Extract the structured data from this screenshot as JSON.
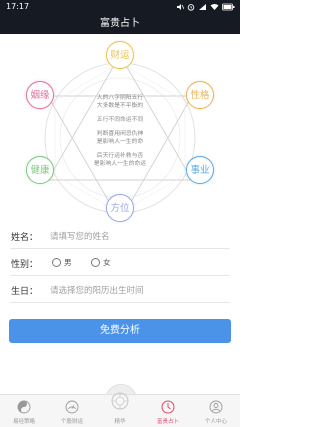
{
  "status_bar": {
    "time": "17:17"
  },
  "header": {
    "title": "富贵占卜"
  },
  "diagram": {
    "nodes": [
      {
        "key": "wealth",
        "label": "财运",
        "color": "#e8c356"
      },
      {
        "key": "character",
        "label": "性格",
        "color": "#e8b45a"
      },
      {
        "key": "career",
        "label": "事业",
        "color": "#5aa8e0"
      },
      {
        "key": "direction",
        "label": "方位",
        "color": "#9aa7e0"
      },
      {
        "key": "health",
        "label": "健康",
        "color": "#7ec77f"
      },
      {
        "key": "marriage",
        "label": "姻缘",
        "color": "#e36f9b"
      }
    ],
    "center_lines": [
      "人的八字阴阳五行",
      "大多数是不平衡的",
      "五行不同命运不同",
      "判断喜用闲忌仇神",
      "是影响人一生的命",
      "后天行运补救与否",
      "是影响人一生的命运"
    ]
  },
  "form": {
    "name": {
      "label": "姓名：",
      "placeholder": "请填写您的姓名"
    },
    "gender": {
      "label": "性别：",
      "options": [
        "男",
        "女"
      ]
    },
    "birthday": {
      "label": "生日：",
      "placeholder": "请选择您的阳历出生时间"
    }
  },
  "submit_label": "免费分析",
  "tabs": [
    {
      "label": "易经策略",
      "icon": "yin-yang-icon",
      "active": false
    },
    {
      "label": "个股财运",
      "icon": "gauge-icon",
      "active": false
    },
    {
      "label": "精华",
      "icon": "bagua-icon",
      "active": false
    },
    {
      "label": "富贵占卜",
      "icon": "divination-icon",
      "active": true
    },
    {
      "label": "个人中心",
      "icon": "person-icon",
      "active": false
    }
  ],
  "colors": {
    "accent": "#4b93e9",
    "active_tab": "#e04a6a",
    "header_bg": "#161a22"
  }
}
